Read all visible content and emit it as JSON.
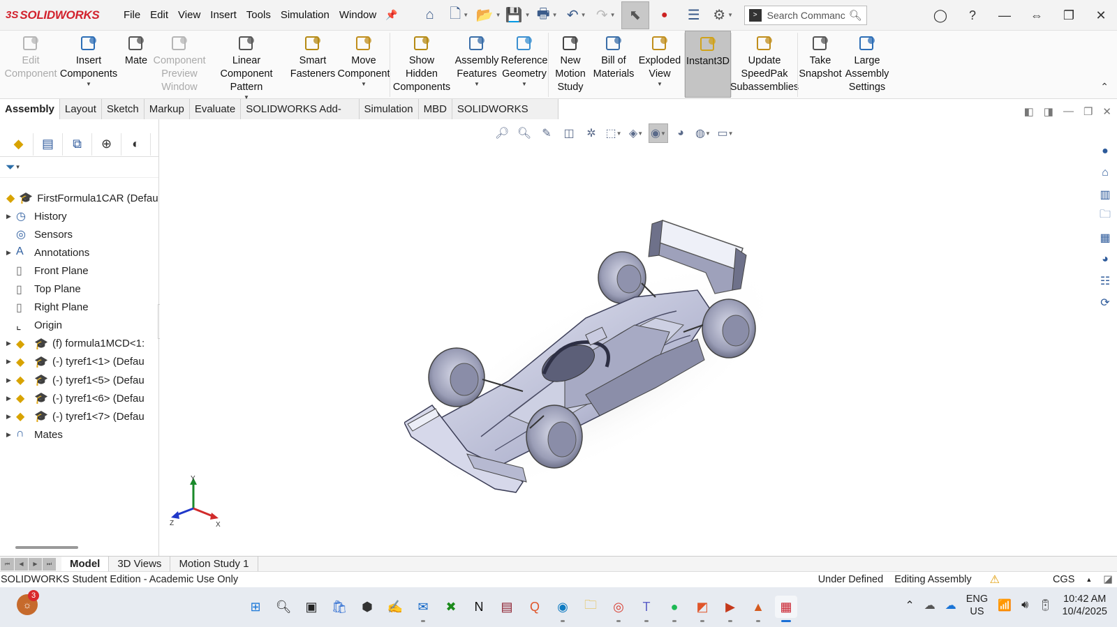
{
  "app": {
    "logo_ds": "3S",
    "logo_name": "SOLIDWORKS"
  },
  "menu": [
    "File",
    "Edit",
    "View",
    "Insert",
    "Tools",
    "Simulation",
    "Window"
  ],
  "search": {
    "placeholder": "Search Commanc"
  },
  "ribbon": [
    {
      "label": "Edit\nComponent",
      "disabled": true,
      "icon": "edit-component-icon"
    },
    {
      "label": "Insert\nComponents",
      "dropdown": true,
      "icon": "insert-components-icon"
    },
    {
      "label": "Mate",
      "icon": "mate-icon"
    },
    {
      "label": "Component\nPreview\nWindow",
      "disabled": true,
      "icon": "component-preview-icon"
    },
    {
      "label": "Linear Component\nPattern",
      "dropdown": true,
      "icon": "linear-pattern-icon"
    },
    {
      "label": "Smart\nFasteners",
      "icon": "smart-fasteners-icon"
    },
    {
      "label": "Move\nComponent",
      "dropdown": true,
      "icon": "move-component-icon"
    },
    {
      "label": "Show\nHidden\nComponents",
      "icon": "show-hidden-icon"
    },
    {
      "label": "Assembly\nFeatures",
      "dropdown": true,
      "icon": "assembly-features-icon"
    },
    {
      "label": "Reference\nGeometry",
      "dropdown": true,
      "icon": "reference-geometry-icon"
    },
    {
      "label": "New\nMotion\nStudy",
      "icon": "motion-study-icon"
    },
    {
      "label": "Bill of\nMaterials",
      "icon": "bom-icon"
    },
    {
      "label": "Exploded\nView",
      "dropdown": true,
      "icon": "exploded-view-icon"
    },
    {
      "label": "Instant3D",
      "active": true,
      "icon": "instant3d-icon"
    },
    {
      "label": "Update\nSpeedPak\nSubassemblies",
      "icon": "speedpak-icon"
    },
    {
      "label": "Take\nSnapshot",
      "icon": "snapshot-icon"
    },
    {
      "label": "Large\nAssembly\nSettings",
      "icon": "large-assembly-icon"
    }
  ],
  "tabs": [
    "Assembly",
    "Layout",
    "Sketch",
    "Markup",
    "Evaluate",
    "SOLIDWORKS Add-Ins",
    "Simulation",
    "MBD",
    "SOLIDWORKS CAM"
  ],
  "active_tab": "Assembly",
  "tree": [
    {
      "label": "FirstFormula1CAR  (Defau",
      "expand": false,
      "kind": "root"
    },
    {
      "label": "History",
      "expand": true,
      "kind": "history"
    },
    {
      "label": "Sensors",
      "expand": false,
      "kind": "sensors"
    },
    {
      "label": "Annotations",
      "expand": true,
      "kind": "annotations"
    },
    {
      "label": "Front Plane",
      "expand": false,
      "kind": "plane"
    },
    {
      "label": "Top Plane",
      "expand": false,
      "kind": "plane"
    },
    {
      "label": "Right Plane",
      "expand": false,
      "kind": "plane"
    },
    {
      "label": "Origin",
      "expand": false,
      "kind": "origin"
    },
    {
      "label": "(f) formula1MCD<1:",
      "expand": true,
      "kind": "part"
    },
    {
      "label": "(-) tyref1<1> (Defau",
      "expand": true,
      "kind": "part"
    },
    {
      "label": "(-) tyref1<5> (Defau",
      "expand": true,
      "kind": "part"
    },
    {
      "label": "(-) tyref1<6> (Defau",
      "expand": true,
      "kind": "part"
    },
    {
      "label": "(-) tyref1<7> (Defau",
      "expand": true,
      "kind": "part"
    },
    {
      "label": "Mates",
      "expand": true,
      "kind": "mates"
    }
  ],
  "model_tabs": [
    "Model",
    "3D Views",
    "Motion Study 1"
  ],
  "status": {
    "left": "SOLIDWORKS Student Edition - Academic Use Only",
    "under_defined": "Under Defined",
    "editing": "Editing Assembly",
    "units": "CGS"
  },
  "taskbar": {
    "weather_badge": "3",
    "lang_line1": "ENG",
    "lang_line2": "US",
    "time": "10:42 AM",
    "date": "10/4/2025"
  },
  "triad": {
    "x": "X",
    "y": "Y",
    "z": "Z"
  },
  "colors": {
    "accent": "#2a60b5",
    "brand": "#d2222d"
  }
}
